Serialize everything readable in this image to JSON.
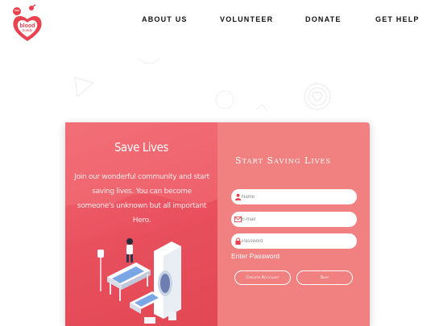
{
  "brand": {
    "logo_text_line1": "blood",
    "logo_text_line2": "buddy",
    "accent_color": "#e8434f",
    "panel_color": "#f08180"
  },
  "nav": {
    "about": "ABOUT US",
    "volunteer": "VOLUNTEER",
    "donate": "DONATE",
    "help": "GET HELP"
  },
  "hero": {
    "title": "Save Lives",
    "body": "Join our wonderful community and start saving lives. You can become someone's unknown but all important Hero."
  },
  "form": {
    "title": "Start Saving Lives",
    "name_placeholder": "Name",
    "email_placeholder": "E-mail",
    "password_placeholder": "Password",
    "password_hint": "Enter Password",
    "create_label": "Create Account",
    "skip_label": "Skip"
  },
  "icons": {
    "name": "user-icon",
    "email": "mail-icon",
    "password": "lock-icon"
  }
}
